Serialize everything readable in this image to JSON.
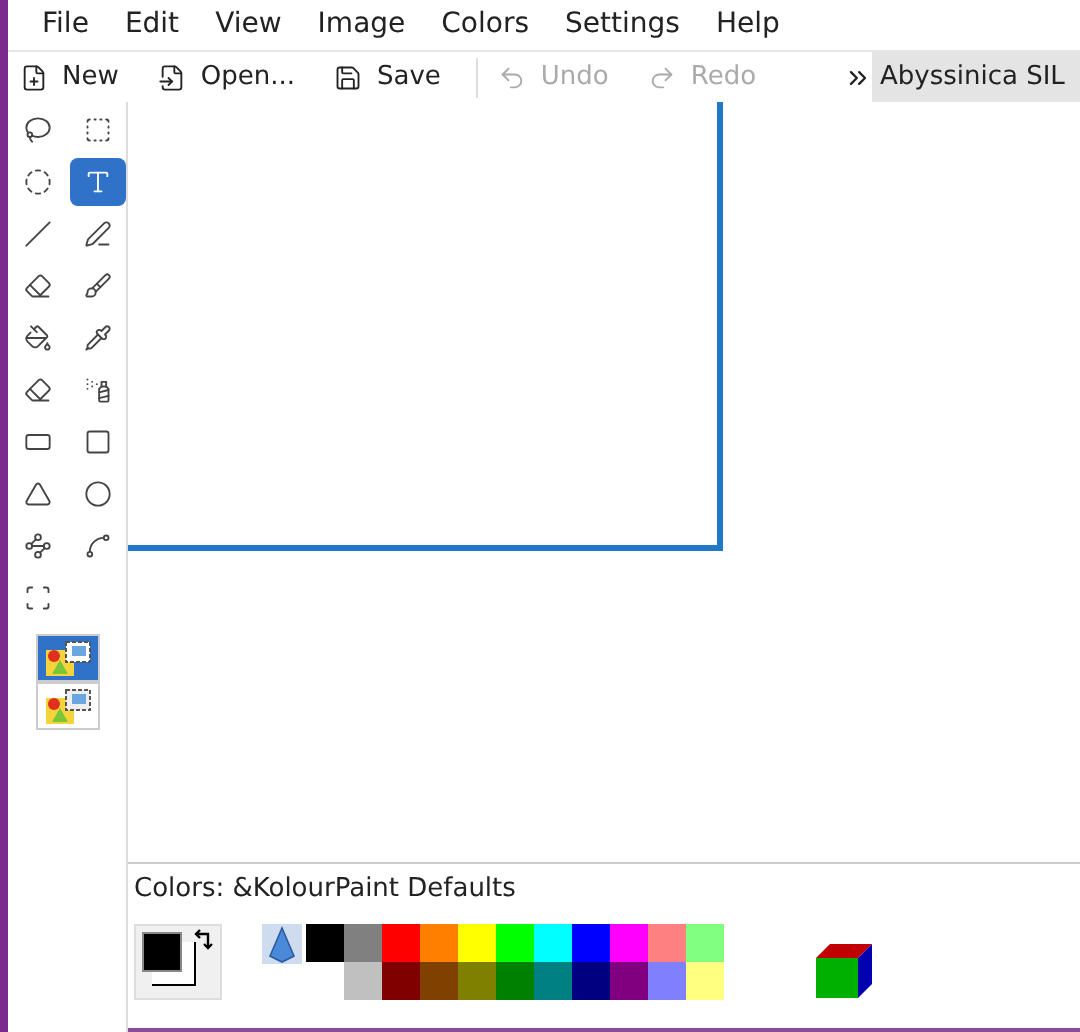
{
  "menu": [
    "File",
    "Edit",
    "View",
    "Image",
    "Colors",
    "Settings",
    "Help"
  ],
  "toolbar": [
    {
      "label": "New",
      "kind": "new",
      "disabled": false
    },
    {
      "label": "Open...",
      "kind": "open",
      "disabled": false
    },
    {
      "label": "Save",
      "kind": "save",
      "disabled": false
    },
    {
      "label": "Undo",
      "kind": "undo",
      "disabled": true
    },
    {
      "label": "Redo",
      "kind": "redo",
      "disabled": true
    }
  ],
  "font_field": {
    "value": "Abyssinica SIL"
  },
  "tools": [
    {
      "kind": "free-select",
      "selected": false
    },
    {
      "kind": "rect-select",
      "selected": false
    },
    {
      "kind": "ellipse-select",
      "selected": false
    },
    {
      "kind": "text",
      "selected": true
    },
    {
      "kind": "line",
      "selected": false
    },
    {
      "kind": "pen",
      "selected": false
    },
    {
      "kind": "eraser",
      "selected": false
    },
    {
      "kind": "brush",
      "selected": false
    },
    {
      "kind": "fill",
      "selected": false
    },
    {
      "kind": "picker",
      "selected": false
    },
    {
      "kind": "color-eraser",
      "selected": false
    },
    {
      "kind": "spray",
      "selected": false
    },
    {
      "kind": "rounded-rect",
      "selected": false
    },
    {
      "kind": "rect",
      "selected": false
    },
    {
      "kind": "polygon",
      "selected": false
    },
    {
      "kind": "ellipse",
      "selected": false
    },
    {
      "kind": "polyline",
      "selected": false
    },
    {
      "kind": "curve",
      "selected": false
    },
    {
      "kind": "zoom",
      "selected": false
    }
  ],
  "selection_modes": [
    {
      "selected": true
    },
    {
      "selected": false
    }
  ],
  "colors_label": "Colors: &KolourPaint Defaults",
  "palette": [
    [
      {
        "color": "#000000"
      },
      {
        "color": "#808080"
      },
      {
        "color": "#ff0000"
      },
      {
        "color": "#ff8000"
      },
      {
        "color": "#ffff00"
      },
      {
        "color": "#00ff00"
      },
      {
        "color": "#00ffff"
      },
      {
        "color": "#0000ff"
      },
      {
        "color": "#ff00ff"
      },
      {
        "color": "#ff8080"
      },
      {
        "color": "#80ff80"
      }
    ],
    [
      {
        "color": "#ffffff"
      },
      {
        "color": "#c0c0c0"
      },
      {
        "color": "#800000"
      },
      {
        "color": "#804000"
      },
      {
        "color": "#808000"
      },
      {
        "color": "#008000"
      },
      {
        "color": "#008080"
      },
      {
        "color": "#000080"
      },
      {
        "color": "#800080"
      },
      {
        "color": "#8080ff"
      },
      {
        "color": "#ffff80"
      }
    ]
  ],
  "foreground": {
    "color": "#000000"
  }
}
